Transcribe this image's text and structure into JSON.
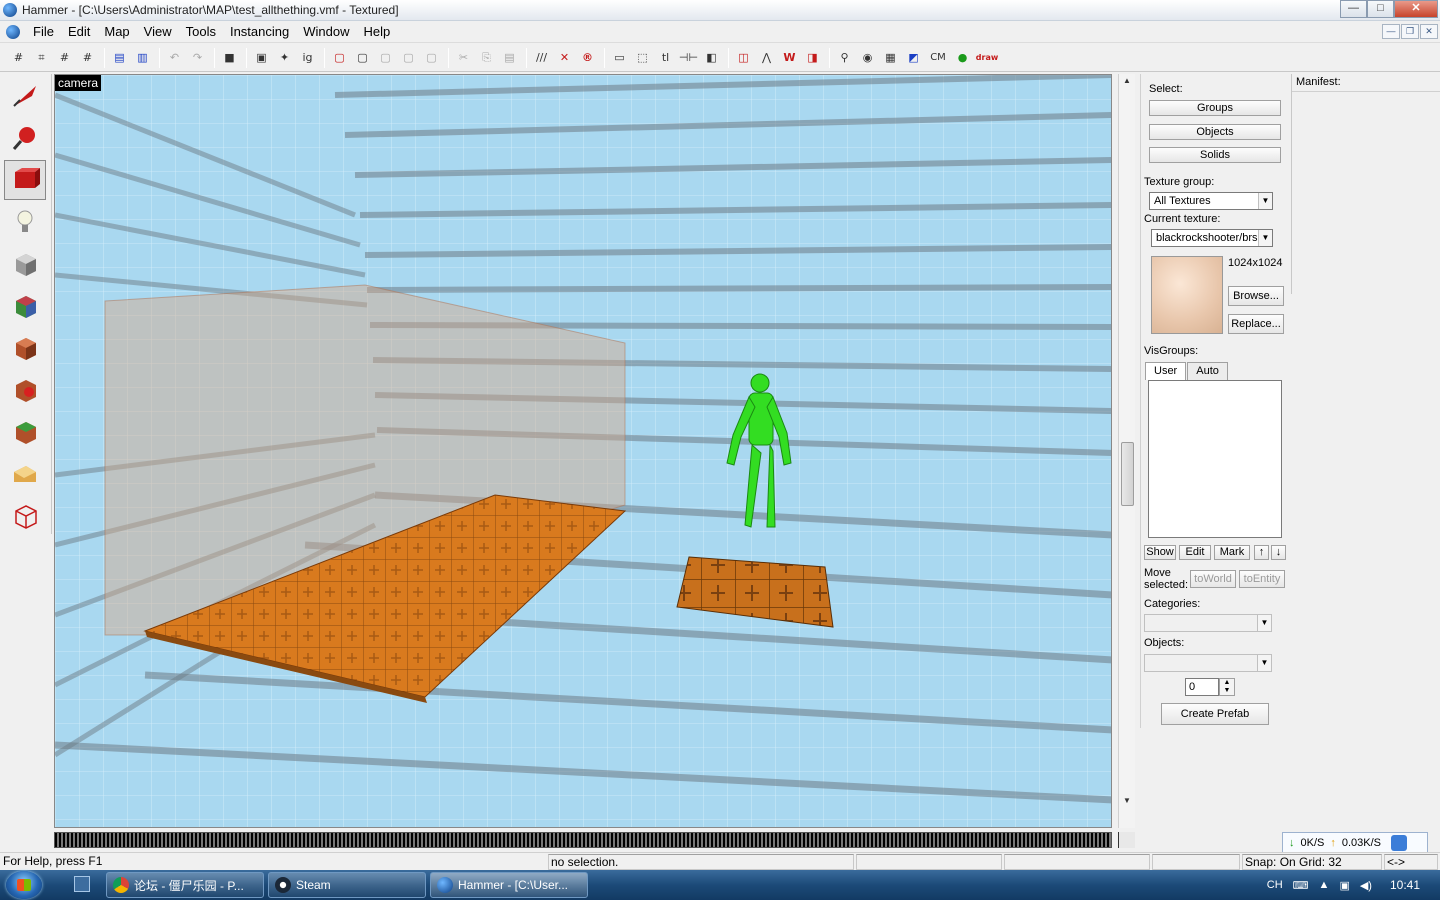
{
  "window": {
    "title": "Hammer - [C:\\Users\\Administrator\\MAP\\test_allthething.vmf - Textured]",
    "controls": [
      "—",
      "□",
      "✕"
    ]
  },
  "menu": {
    "items": [
      "File",
      "Edit",
      "Map",
      "View",
      "Tools",
      "Instancing",
      "Window",
      "Help"
    ],
    "mdi_controls": [
      "—",
      "❐",
      "✕"
    ]
  },
  "toolbar": {
    "text_buttons": {
      "cm": "CM",
      "draw": "draw"
    },
    "icons": [
      "grid-icon",
      "grid-snap-icon",
      "grid-larger-icon",
      "grid-smaller-icon",
      "group-icon",
      "ungroup-icon",
      "undo-icon",
      "redo-icon",
      "carve-icon",
      "cut-icon",
      "copy-icon",
      "paste-icon"
    ]
  },
  "viewport": {
    "label": "camera"
  },
  "side_panel": {
    "select_label": "Select:",
    "select_buttons": [
      "Groups",
      "Objects",
      "Solids"
    ],
    "texture_group_label": "Texture group:",
    "texture_group_value": "All Textures",
    "current_texture_label": "Current texture:",
    "current_texture_value": "blackrockshooter/brsbd",
    "texture_size": "1024x1024",
    "browse_button": "Browse...",
    "replace_button": "Replace...",
    "visgroups_label": "VisGroups:",
    "visgroup_tabs": [
      "User",
      "Auto"
    ],
    "vis_buttons": {
      "show": "Show",
      "edit": "Edit",
      "mark": "Mark",
      "up": "↑",
      "down": "↓"
    },
    "move_selected_label": "Move selected:",
    "to_world_button": "toWorld",
    "to_entity_button": "toEntity",
    "categories_label": "Categories:",
    "objects_label": "Objects:",
    "spinner_value": "0",
    "create_prefab_button": "Create Prefab"
  },
  "manifest": {
    "label": "Manifest:"
  },
  "status": {
    "help": "For Help, press F1",
    "selection": "no selection.",
    "snap": "Snap: On Grid: 32",
    "arrows": "<->"
  },
  "network": {
    "down": "0K/S",
    "up": "0.03K/S"
  },
  "taskbar": {
    "tasks": [
      {
        "label": "论坛 - 僵尸乐园 - P...",
        "icon": "chrome-icon"
      },
      {
        "label": "Steam",
        "icon": "steam-icon"
      },
      {
        "label": "Hammer - [C:\\User...",
        "icon": "hammer-icon"
      }
    ],
    "ime": "CH",
    "clock": "10:41"
  },
  "colors": {
    "floor_tiles": "#d97a1e",
    "player_model": "#33dd22",
    "trigger_volume": "#d8a888",
    "sky_wall": "#a9d8f0"
  }
}
